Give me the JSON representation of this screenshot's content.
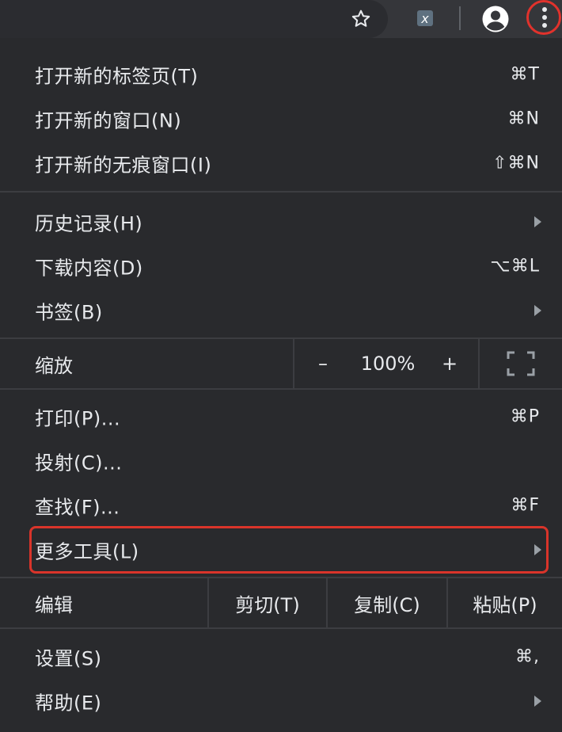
{
  "toolbar": {
    "star_icon": "star-outline-icon",
    "extension_icon": "extension-x-icon",
    "profile_icon": "account-circle-icon",
    "menu_icon": "more-vert-icon"
  },
  "menu": {
    "group1": [
      {
        "label": "打开新的标签页(T)",
        "shortcut": "⌘T"
      },
      {
        "label": "打开新的窗口(N)",
        "shortcut": "⌘N"
      },
      {
        "label": "打开新的无痕窗口(I)",
        "shortcut": "⇧⌘N"
      }
    ],
    "group2": [
      {
        "label": "历史记录(H)",
        "shortcut": ""
      },
      {
        "label": "下载内容(D)",
        "shortcut": "⌥⌘L"
      },
      {
        "label": "书签(B)",
        "shortcut": ""
      }
    ],
    "zoom": {
      "label": "缩放",
      "minus": "–",
      "value": "100%",
      "plus": "+"
    },
    "group3": [
      {
        "label": "打印(P)...",
        "shortcut": "⌘P"
      },
      {
        "label": "投射(C)...",
        "shortcut": ""
      },
      {
        "label": "查找(F)...",
        "shortcut": "⌘F"
      },
      {
        "label": "更多工具(L)",
        "shortcut": ""
      }
    ],
    "edit": {
      "label": "编辑",
      "cut": "剪切(T)",
      "copy": "复制(C)",
      "paste": "粘贴(P)"
    },
    "group4": [
      {
        "label": "设置(S)",
        "shortcut": "⌘,"
      },
      {
        "label": "帮助(E)",
        "shortcut": ""
      }
    ]
  },
  "colors": {
    "menu_bg": "#292a2d",
    "text": "#e8eaed",
    "highlight": "#d9342a"
  }
}
